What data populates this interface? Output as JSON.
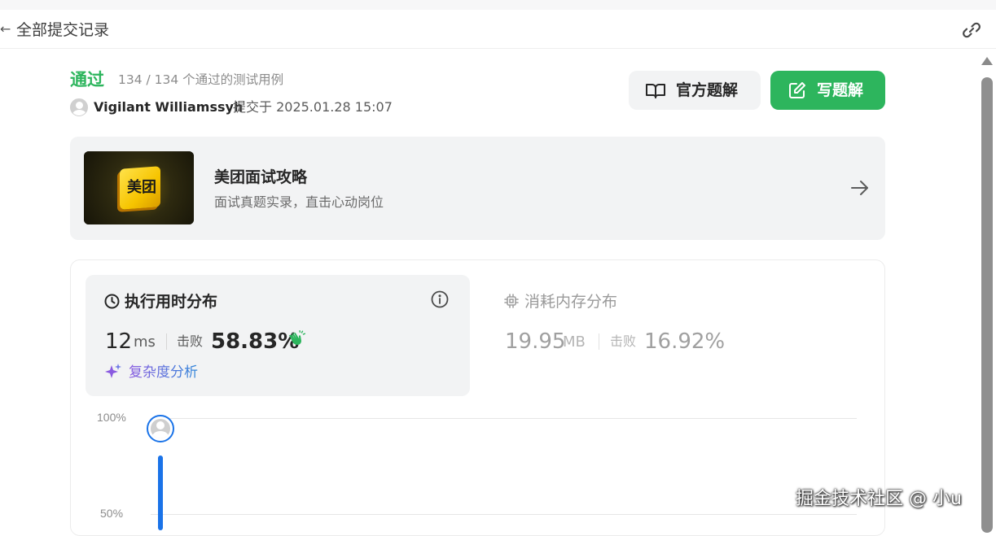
{
  "header": {
    "back_glyph": "←",
    "title": "全部提交记录"
  },
  "submission": {
    "status": "通过",
    "status_color": "#2db55d",
    "detail": "134 / 134 个通过的测试用例",
    "author": "Vigilant Williamssyh",
    "submitted_at": "提交于 2025.01.28 15:07"
  },
  "actions": {
    "official_solution": "官方题解",
    "write_solution": "写题解"
  },
  "banner": {
    "logo_text": "美团",
    "title": "美团面试攻略",
    "subtitle": "面试真题实录，直击心动岗位"
  },
  "runtime": {
    "title": "执行用时分布",
    "value": "12",
    "unit": "ms",
    "beats_label": "击败",
    "beats_value": "58.83%",
    "complexity_link": "复杂度分析"
  },
  "memory": {
    "title": "消耗内存分布",
    "value": "19.95",
    "unit": "MB",
    "beats_label": "击败",
    "beats_value": "16.92%"
  },
  "chart_data": {
    "type": "bar",
    "yticks": [
      "100%",
      "50%"
    ],
    "ylim": [
      0,
      100
    ],
    "user_bar_percent": 100,
    "bar_color": "#1a73e8"
  },
  "watermark": "掘金技术社区 @ 小u",
  "colors": {
    "accent_green": "#2db55d",
    "accent_blue": "#1a73e8"
  }
}
